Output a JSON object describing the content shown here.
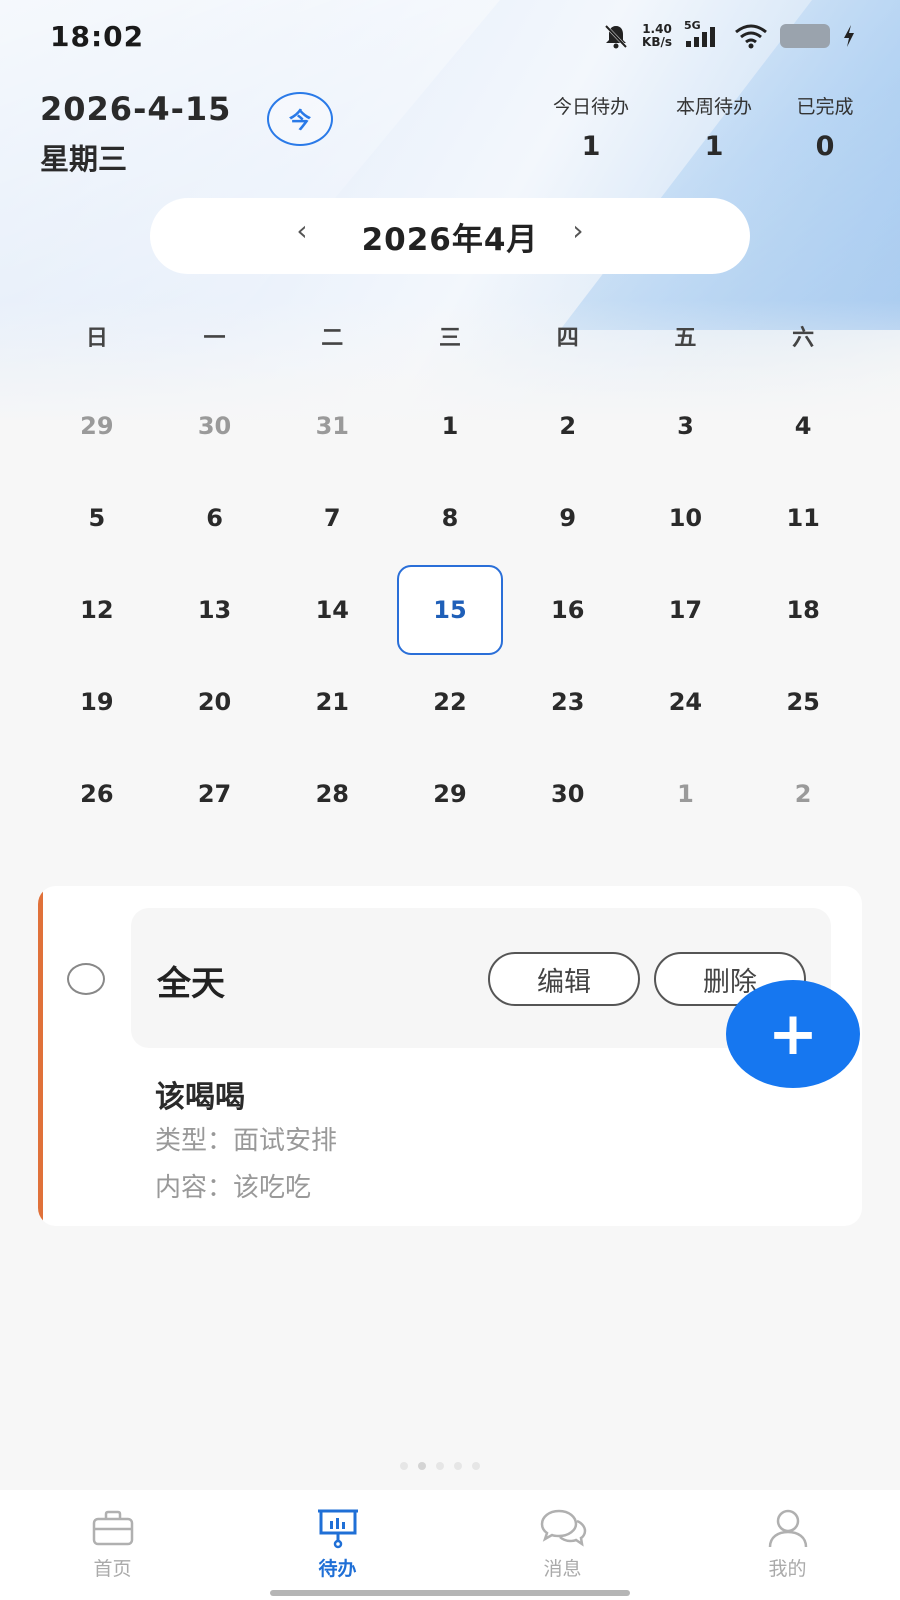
{
  "status_bar": {
    "time": "18:02",
    "net_speed_value": "1.40",
    "net_speed_unit": "KB/s",
    "network": "5G",
    "icons": [
      "bell-muted-icon",
      "signal-icon",
      "wifi-icon",
      "battery-icon",
      "charging-icon"
    ]
  },
  "header": {
    "date": "2026-4-15",
    "weekday": "星期三",
    "today_button": "今",
    "stats": [
      {
        "label": "今日待办",
        "value": "1"
      },
      {
        "label": "本周待办",
        "value": "1"
      },
      {
        "label": "已完成",
        "value": "0"
      }
    ]
  },
  "month_bar": {
    "title": "2026年4月",
    "prev_icon": "chevron-left-icon",
    "next_icon": "chevron-right-icon"
  },
  "calendar": {
    "weekdays": [
      "日",
      "一",
      "二",
      "三",
      "四",
      "五",
      "六"
    ],
    "days": [
      {
        "d": "29",
        "muted": true
      },
      {
        "d": "30",
        "muted": true
      },
      {
        "d": "31",
        "muted": true
      },
      {
        "d": "1"
      },
      {
        "d": "2"
      },
      {
        "d": "3"
      },
      {
        "d": "4"
      },
      {
        "d": "5"
      },
      {
        "d": "6"
      },
      {
        "d": "7"
      },
      {
        "d": "8"
      },
      {
        "d": "9"
      },
      {
        "d": "10"
      },
      {
        "d": "11"
      },
      {
        "d": "12"
      },
      {
        "d": "13"
      },
      {
        "d": "14"
      },
      {
        "d": "15",
        "selected": true
      },
      {
        "d": "16"
      },
      {
        "d": "17"
      },
      {
        "d": "18"
      },
      {
        "d": "19"
      },
      {
        "d": "20"
      },
      {
        "d": "21"
      },
      {
        "d": "22"
      },
      {
        "d": "23"
      },
      {
        "d": "24"
      },
      {
        "d": "25"
      },
      {
        "d": "26"
      },
      {
        "d": "27"
      },
      {
        "d": "28"
      },
      {
        "d": "29"
      },
      {
        "d": "30"
      },
      {
        "d": "1",
        "muted": true
      },
      {
        "d": "2",
        "muted": true
      }
    ]
  },
  "task": {
    "time": "全天",
    "edit_label": "编辑",
    "delete_label": "删除",
    "title": "该喝喝",
    "type_text": "类型：面试安排",
    "content_text": "内容：该吃吃",
    "accent_color": "#e0713a"
  },
  "fab": {
    "label": "+"
  },
  "tabbar": {
    "items": [
      {
        "label": "首页",
        "icon": "briefcase-icon",
        "active": false
      },
      {
        "label": "待办",
        "icon": "presentation-board-icon",
        "active": true
      },
      {
        "label": "消息",
        "icon": "chat-bubbles-icon",
        "active": false
      },
      {
        "label": "我的",
        "icon": "user-icon",
        "active": false
      }
    ]
  },
  "colors": {
    "accent": "#1677f0",
    "active_tab": "#1f6fd6"
  }
}
